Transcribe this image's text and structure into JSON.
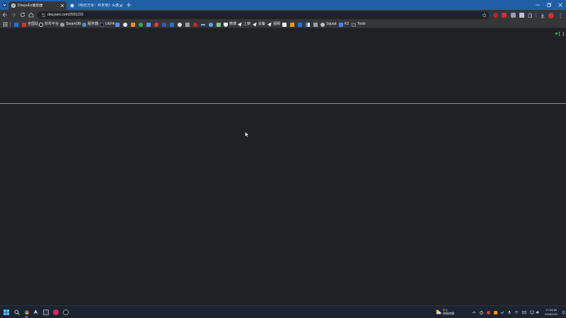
{
  "browser": {
    "tabs": [
      {
        "title": "DouyuEx播放器",
        "active": true
      },
      {
        "title": "《明日方舟：终末地》头像公测",
        "active": false
      }
    ],
    "address_bar": {
      "url": "douyuex.com/2501233"
    },
    "bookmarks": [
      {
        "label": "全国站"
      },
      {
        "label": "抖币平台"
      },
      {
        "label": "SteamDB"
      },
      {
        "label": "服务器"
      },
      {
        "label": "UEFA"
      },
      {
        "label": "微博"
      },
      {
        "label": "上架"
      },
      {
        "label": "设备"
      },
      {
        "label": "视频"
      },
      {
        "label": "Squad"
      },
      {
        "label": "K2"
      },
      {
        "label": "Tools"
      }
    ]
  },
  "taskbar": {
    "weather": {
      "temperature": "3°C",
      "condition": "阴雨转晴"
    },
    "clock": {
      "time": "17:03:48",
      "date": "2026/1/20"
    }
  },
  "icons": {
    "tab_search": "chevron-down-icon",
    "new_tab": "plus-icon",
    "window_controls": [
      "minimize-icon",
      "restore-icon",
      "close-icon"
    ],
    "navigation": [
      "back-arrow-icon",
      "forward-arrow-icon",
      "reload-icon",
      "home-icon"
    ],
    "omnibox": [
      "site-info-icon",
      "star-icon"
    ],
    "toolbar_right": [
      "extensions-puzzle-icon",
      "download-icon",
      "profile-avatar-icon",
      "kebab-menu-icon"
    ],
    "bookmarks": [
      "apps-grid-icon",
      "folder-icon"
    ],
    "page": [
      "status-dot",
      "expand-icon",
      "mouse-cursor-icon"
    ],
    "taskbar": [
      "windows-start-icon",
      "search-icon",
      "chrome-icon",
      "steam-icon",
      "terminal-icon",
      "weather-icon",
      "chevron-up-icon",
      "network-icon",
      "volume-icon",
      "bell-icon"
    ]
  },
  "colors": {
    "title_bar": "#1f5fa6",
    "toolbar": "#35363a",
    "page_background": "#202124",
    "divider_line": "#8f8f8f",
    "status_dot": "#2ecc40",
    "taskbar": "#1b2430"
  }
}
